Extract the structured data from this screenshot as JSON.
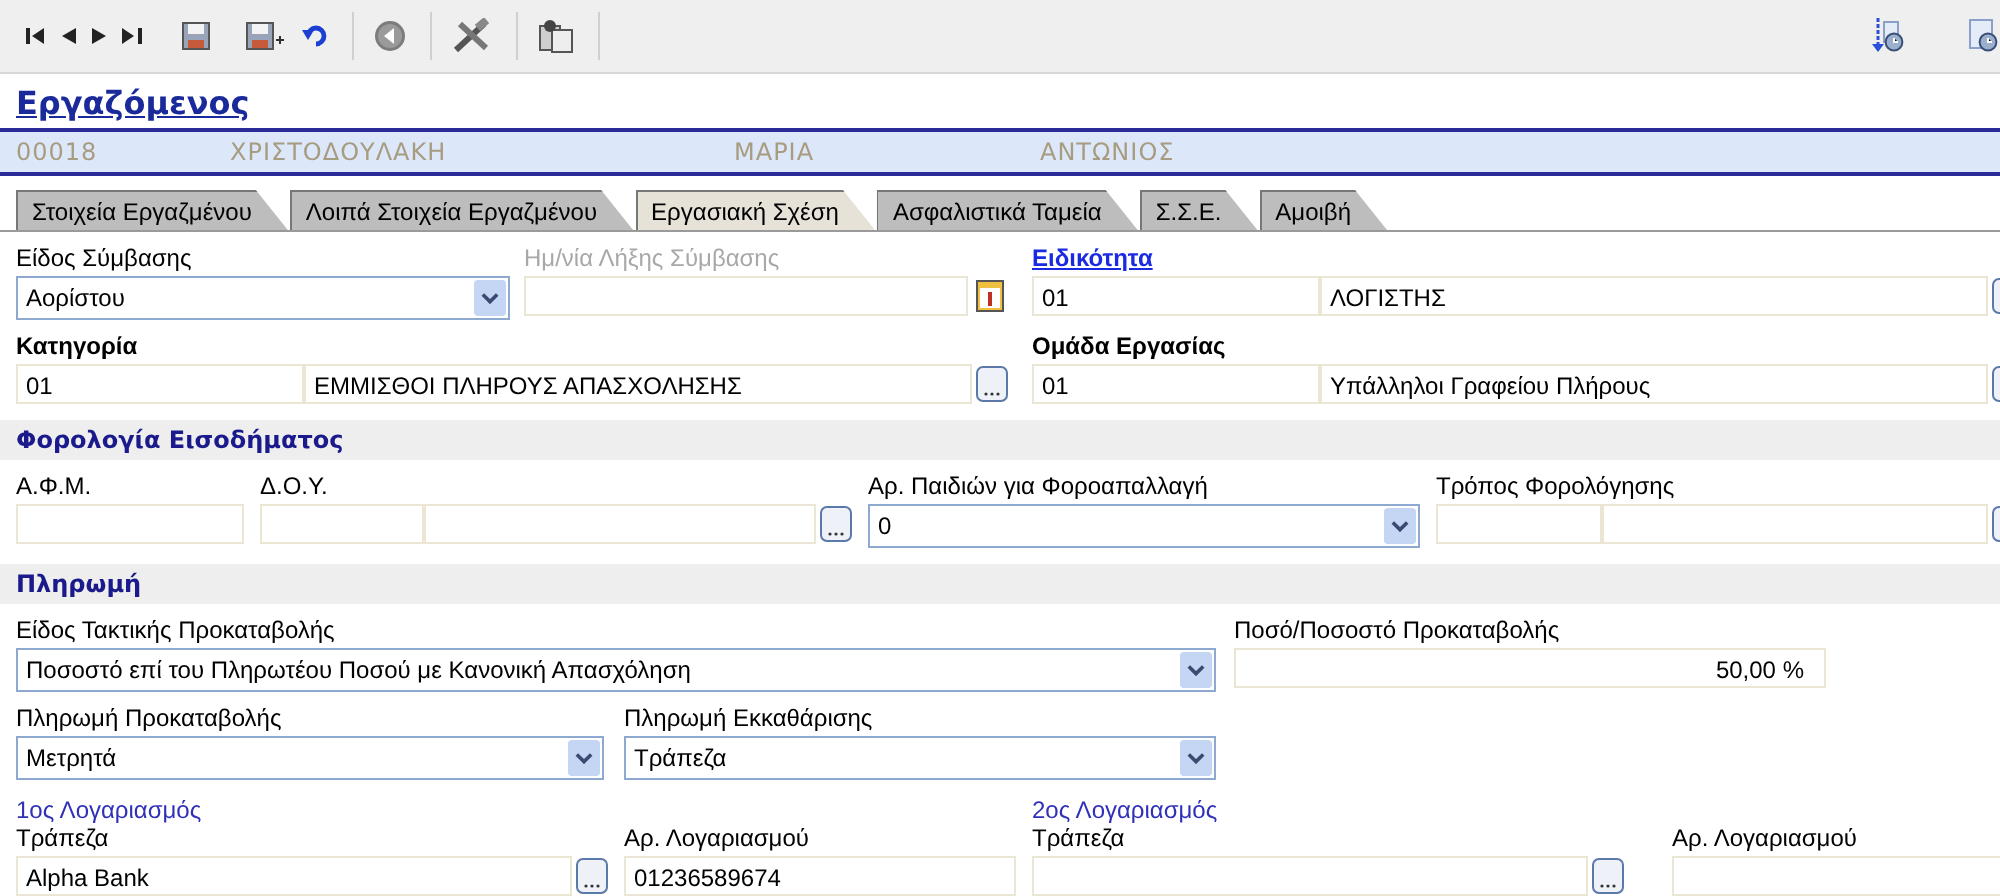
{
  "title": "Εργαζόμενος",
  "record": [
    "00018",
    "ΧΡΙΣΤΟΔΟΥΛΑΚΗ",
    "ΜΑΡΙΑ",
    "ΑΝΤΩΝΙΟΣ"
  ],
  "tabs": [
    {
      "label": "Στοιχεία Εργαζμένου",
      "selected": false
    },
    {
      "label": "Λοιπά Στοιχεία Εργαζμένου",
      "selected": false
    },
    {
      "label": "Εργασιακή Σχέση",
      "selected": true
    },
    {
      "label": "Ασφαλιστικά Ταμεία",
      "selected": false
    },
    {
      "label": "Σ.Σ.Ε.",
      "selected": false
    },
    {
      "label": "Αμοιβή",
      "selected": false
    }
  ],
  "contract": {
    "type": {
      "label": "Είδος Σύμβασης",
      "value": "Αορίστου"
    },
    "end_date": {
      "label": "Ημ/νία Λήξης Σύμβασης",
      "disabled": true
    },
    "specialty": {
      "label": "Ειδικότητα",
      "code": "01",
      "name": "ΛΟΓΙΣΤΗΣ"
    },
    "category": {
      "label": "Κατηγορία",
      "code": "01",
      "name": "ΕΜΜΙΣΘΟΙ ΠΛΗΡΟΥΣ ΑΠΑΣΧΟΛΗΣΗΣ"
    },
    "work_group": {
      "label": "Ομάδα Εργασίας",
      "code": "01",
      "name": "Υπάλληλοι Γραφείου Πλήρους"
    }
  },
  "income_tax": {
    "title": "Φορολογία Εισοδήματος",
    "afm": {
      "label": "Α.Φ.Μ."
    },
    "doy": {
      "label": "Δ.Ο.Υ."
    },
    "children": {
      "label": "Αρ. Παιδιών για Φοροαπαλλαγή",
      "value": "0"
    },
    "tax_method": {
      "label": "Τρόπος Φορολόγησης"
    }
  },
  "payment": {
    "title": "Πληρωμή",
    "advance_type": {
      "label": "Είδος Τακτικής Προκαταβολής",
      "value": "Ποσοστό επί του Πληρωτέου Ποσού με Κανονική Απασχόληση"
    },
    "advance_amount": {
      "label": "Ποσό/Ποσοστό Προκαταβολής",
      "value": "50,00 %"
    },
    "advance_payment": {
      "label": "Πληρωμή Προκαταβολής",
      "value": "Μετρητά"
    },
    "settlement_payment": {
      "label": "Πληρωμή Εκκαθάρισης",
      "value": "Τράπεζα"
    },
    "accounts": [
      {
        "title": "1ος Λογαριασμός",
        "bank": {
          "label": "Τράπεζα",
          "value": "Alpha Bank"
        },
        "number": {
          "label": "Αρ. Λογαριασμού",
          "value": "01236589674"
        }
      },
      {
        "title": "2ος Λογαριασμός",
        "bank": {
          "label": "Τράπεζα"
        },
        "number": {
          "label": "Αρ. Λογαριασμού"
        }
      }
    ]
  }
}
